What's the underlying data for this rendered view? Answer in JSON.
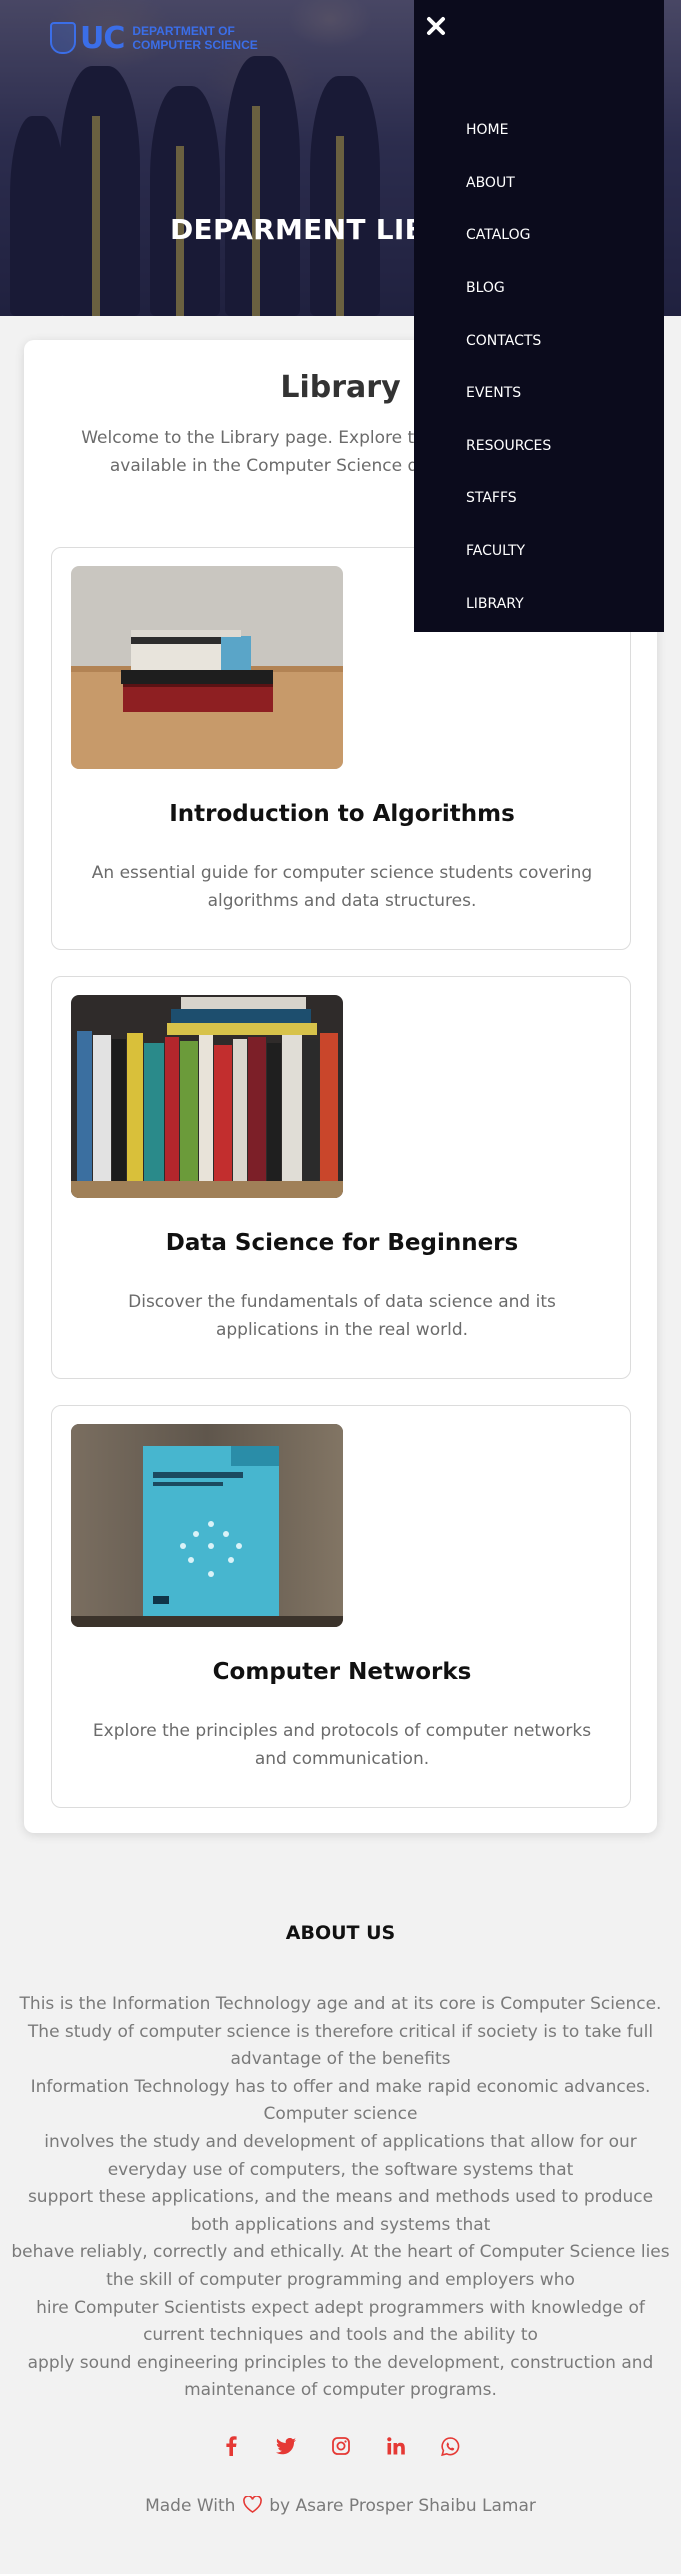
{
  "brand": {
    "logo_letters": "UC",
    "logo_text_line1": "Department of",
    "logo_text_line2": "Computer Science"
  },
  "hero": {
    "title": "DEPARMENT LIBRARY"
  },
  "nav": {
    "close_icon": "close-icon",
    "items": [
      {
        "label": "HOME"
      },
      {
        "label": "ABOUT"
      },
      {
        "label": "CATALOG"
      },
      {
        "label": "BLOG"
      },
      {
        "label": "CONTACTS"
      },
      {
        "label": "EVENTS"
      },
      {
        "label": "RESOURCES"
      },
      {
        "label": "STAFFS"
      },
      {
        "label": "FACULTY"
      },
      {
        "label": "LIBRARY"
      }
    ]
  },
  "library": {
    "heading": "Library",
    "intro": "Welcome to the Library page. Explore the range of resources available in the Computer Science department library.",
    "books": [
      {
        "title": "Introduction to Algorithms",
        "description": "An essential guide for computer science students covering algorithms and data structures.",
        "image_alt": "Algorithms book on wooden table"
      },
      {
        "title": "Data Science for Beginners",
        "description": "Discover the fundamentals of data science and its applications in the real world.",
        "image_alt": "Shelf of data science books"
      },
      {
        "title": "Computer Networks",
        "description": "Explore the principles and protocols of computer networks and communication.",
        "image_alt": "Computer Networking book cover"
      }
    ]
  },
  "about": {
    "heading": "ABOUT US",
    "lines": [
      "This is the Information Technology age and at its core is Computer Science.",
      "The study of computer science is therefore critical if society is to take full advantage of the benefits",
      "Information Technology has to offer and make rapid economic advances. Computer science",
      "involves the study and development of applications that allow for our everyday use of computers, the software systems that",
      "support these applications, and the means and methods used to produce both applications and systems that",
      "behave reliably, correctly and ethically. At the heart of Computer Science lies the skill of computer programming and employers who",
      "hire Computer Scientists expect adept programmers with knowledge of current techniques and tools and the ability to",
      "apply sound engineering principles to the development, construction and maintenance of computer programs."
    ]
  },
  "social": {
    "color": "#e53935",
    "icons": [
      "facebook-icon",
      "twitter-icon",
      "instagram-icon",
      "linkedin-icon",
      "whatsapp-icon"
    ]
  },
  "footer": {
    "made_with": "Made With",
    "by": "by Asare Prosper Shaibu Lamar",
    "heart_color": "#e53935"
  },
  "colors": {
    "drawer_bg": "#0b0b1c",
    "page_bg": "#f2f2f2",
    "card_bg": "#ffffff",
    "brand_blue": "#3b6ee8"
  }
}
